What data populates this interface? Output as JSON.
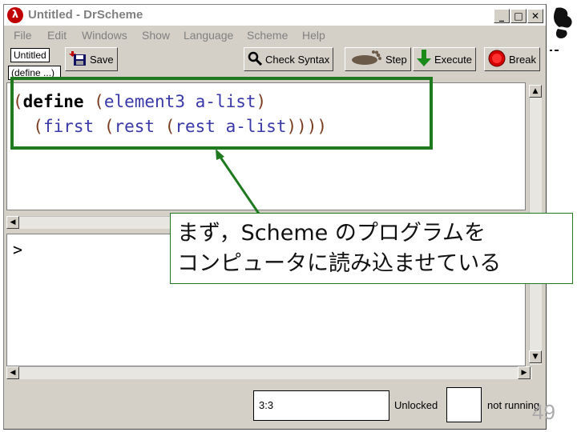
{
  "window": {
    "title": "Untitled - DrScheme",
    "logo_glyph": "λ",
    "controls": {
      "minimize": "_",
      "maximize": "□",
      "close": "✕"
    }
  },
  "menubar": {
    "items": [
      {
        "label": "File"
      },
      {
        "label": "Edit"
      },
      {
        "label": "Windows"
      },
      {
        "label": "Show"
      },
      {
        "label": "Language"
      },
      {
        "label": "Scheme"
      },
      {
        "label": "Help"
      }
    ]
  },
  "toolbar": {
    "filename_label": "Untitled",
    "define_menu_label": "(define ...)",
    "save_label": "Save",
    "check_syntax_label": "Check Syntax",
    "step_label": "Step",
    "execute_label": "Execute",
    "break_label": "Break"
  },
  "editor": {
    "line1": {
      "open": "(",
      "kw": "define",
      "space": " ",
      "p2": "(",
      "name": "element3",
      "sp": " ",
      "arg": "a-list",
      "close": ")"
    },
    "line2": {
      "indent": "  ",
      "p1": "(",
      "first": "first",
      "sp1": " ",
      "p2": "(",
      "rest1": "rest",
      "sp2": " ",
      "p3": "(",
      "rest2": "rest",
      "sp3": " ",
      "arg": "a-list",
      "close": "))))"
    }
  },
  "interactions": {
    "prompt": ">"
  },
  "statusbar": {
    "position": "3:3",
    "lock_state": "Unlocked",
    "running_state": "not running"
  },
  "callout": {
    "line1": "まず，Scheme のプログラムを",
    "line2": "コンピュータに読み込ませている"
  },
  "slide": {
    "page_number": "49"
  },
  "colors": {
    "highlight": "#1f7a1f",
    "identifier": "#3838a8",
    "paren": "#7a3c20"
  }
}
